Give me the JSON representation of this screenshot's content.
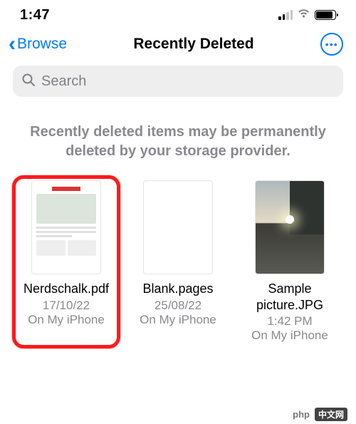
{
  "status": {
    "time": "1:47"
  },
  "nav": {
    "back_label": "Browse",
    "title": "Recently Deleted",
    "more_glyph": "•••"
  },
  "search": {
    "placeholder": "Search"
  },
  "info_text": "Recently deleted items may be permanently deleted by your storage provider.",
  "files": [
    {
      "name": "Nerdschalk.pdf",
      "date": "17/10/22",
      "location": "On My iPhone",
      "highlighted": true
    },
    {
      "name": "Blank.pages",
      "date": "25/08/22",
      "location": "On My iPhone",
      "highlighted": false
    },
    {
      "name": "Sample picture.JPG",
      "date": "1:42 PM",
      "location": "On My iPhone",
      "highlighted": false
    }
  ],
  "watermark": {
    "brand": "php",
    "cn": "中文网"
  }
}
